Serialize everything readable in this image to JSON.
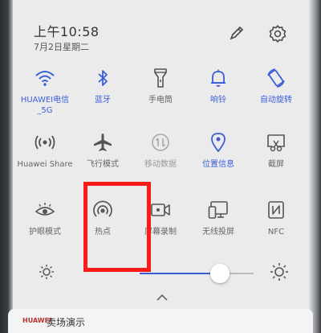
{
  "status": {
    "time": "上午10:58",
    "date": "7月2日星期二"
  },
  "tiles": [
    {
      "icon": "wifi-icon",
      "label": "HUAWEI电信\n_5G",
      "state": "on"
    },
    {
      "icon": "bluetooth-icon",
      "label": "蓝牙",
      "state": "on"
    },
    {
      "icon": "flashlight-icon",
      "label": "手电筒",
      "state": "normal"
    },
    {
      "icon": "bell-icon",
      "label": "响铃",
      "state": "on"
    },
    {
      "icon": "auto-rotate-icon",
      "label": "自动旋转",
      "state": "on"
    },
    {
      "icon": "huawei-share-icon",
      "label": "Huawei Share",
      "state": "normal"
    },
    {
      "icon": "airplane-icon",
      "label": "飞行模式",
      "state": "normal"
    },
    {
      "icon": "mobile-data-icon",
      "label": "移动数据",
      "state": "off"
    },
    {
      "icon": "location-icon",
      "label": "位置信息",
      "state": "on"
    },
    {
      "icon": "screenshot-icon",
      "label": "截屏",
      "state": "normal"
    },
    {
      "icon": "eye-comfort-icon",
      "label": "护眼模式",
      "state": "normal"
    },
    {
      "icon": "hotspot-icon",
      "label": "热点",
      "state": "normal"
    },
    {
      "icon": "screen-record-icon",
      "label": "屏幕录制",
      "state": "normal"
    },
    {
      "icon": "wireless-projection-icon",
      "label": "无线投屏",
      "state": "normal"
    },
    {
      "icon": "nfc-icon",
      "label": "NFC",
      "state": "normal"
    }
  ],
  "brightness": {
    "level": 0.75
  },
  "notification": {
    "app_logo": "HUAWEI",
    "title": "卖场演示"
  },
  "colors": {
    "accent": "#3b5ed8",
    "highlight": "#ff1a1a"
  }
}
